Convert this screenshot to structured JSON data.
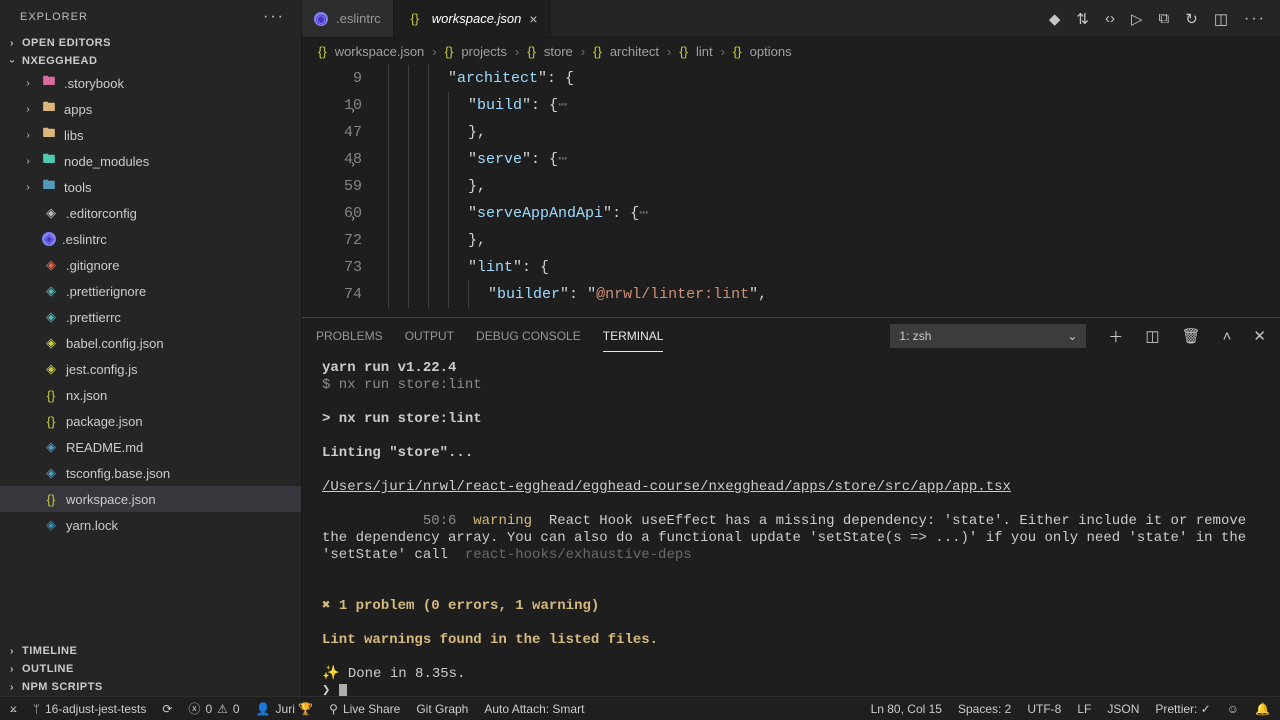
{
  "explorer": {
    "title": "EXPLORER",
    "sections": {
      "open_editors": "OPEN EDITORS",
      "project": "NXEGGHEAD",
      "timeline": "TIMELINE",
      "outline": "OUTLINE",
      "npm_scripts": "NPM SCRIPTS"
    },
    "tree": [
      {
        "type": "folder",
        "label": ".storybook",
        "iconClass": "ic-folder-pink"
      },
      {
        "type": "folder",
        "label": "apps",
        "iconClass": "ic-folder-tan"
      },
      {
        "type": "folder",
        "label": "libs",
        "iconClass": "ic-folder-tan"
      },
      {
        "type": "folder",
        "label": "node_modules",
        "iconClass": "ic-folder-teal"
      },
      {
        "type": "folder",
        "label": "tools",
        "iconClass": "ic-folder-blue"
      },
      {
        "type": "file",
        "label": ".editorconfig",
        "iconClass": "ic-cog"
      },
      {
        "type": "file",
        "label": ".eslintrc",
        "iconClass": "ic-eslint"
      },
      {
        "type": "file",
        "label": ".gitignore",
        "iconClass": "ic-git"
      },
      {
        "type": "file",
        "label": ".prettierignore",
        "iconClass": "ic-prettier"
      },
      {
        "type": "file",
        "label": ".prettierrc",
        "iconClass": "ic-prettier"
      },
      {
        "type": "file",
        "label": "babel.config.json",
        "iconClass": "ic-babel"
      },
      {
        "type": "file",
        "label": "jest.config.js",
        "iconClass": "ic-js"
      },
      {
        "type": "file",
        "label": "nx.json",
        "iconClass": "ic-json"
      },
      {
        "type": "file",
        "label": "package.json",
        "iconClass": "ic-json"
      },
      {
        "type": "file",
        "label": "README.md",
        "iconClass": "ic-md"
      },
      {
        "type": "file",
        "label": "tsconfig.base.json",
        "iconClass": "ic-ts"
      },
      {
        "type": "file",
        "label": "workspace.json",
        "iconClass": "ic-json",
        "selected": true
      },
      {
        "type": "file",
        "label": "yarn.lock",
        "iconClass": "ic-yarn"
      }
    ]
  },
  "tabs": [
    {
      "label": ".eslintrc",
      "icon": "ic-eslint",
      "active": false
    },
    {
      "label": "workspace.json",
      "icon": "ic-json",
      "active": true
    }
  ],
  "breadcrumbs": [
    "workspace.json",
    "projects",
    "store",
    "architect",
    "lint",
    "options"
  ],
  "breadcrumbs_icons": [
    "{}",
    "{}",
    "{}",
    "{}",
    "{}",
    "{}"
  ],
  "code": {
    "lines": [
      {
        "n": 9,
        "indent": 3,
        "key": "architect",
        "after": ": {"
      },
      {
        "n": 10,
        "indent": 4,
        "key": "build",
        "after": ": {",
        "fold": true,
        "ell": true
      },
      {
        "n": 47,
        "indent": 4,
        "raw": "},",
        "plain": true
      },
      {
        "n": 48,
        "indent": 4,
        "key": "serve",
        "after": ": {",
        "fold": true,
        "ell": true
      },
      {
        "n": 59,
        "indent": 4,
        "raw": "},",
        "plain": true
      },
      {
        "n": 60,
        "indent": 4,
        "key": "serveAppAndApi",
        "after": ": {",
        "fold": true,
        "ell": true
      },
      {
        "n": 72,
        "indent": 4,
        "raw": "},",
        "plain": true
      },
      {
        "n": 73,
        "indent": 4,
        "key": "lint",
        "after": ": {"
      },
      {
        "n": 74,
        "indent": 5,
        "key": "builder",
        "after": ": ",
        "str": "@nrwl/linter:lint",
        "tail": ","
      }
    ]
  },
  "panel": {
    "tabs": {
      "problems": "PROBLEMS",
      "output": "OUTPUT",
      "debug": "DEBUG CONSOLE",
      "terminal": "TERMINAL"
    },
    "term_selector": "1: zsh",
    "terminal_lines": {
      "l1": "yarn run v1.22.4",
      "l2": "$ nx run store:lint",
      "l3": "> nx run store:lint",
      "l4": "Linting \"store\"...",
      "l5": "/Users/juri/nrwl/react-egghead/egghead-course/nxegghead/apps/store/src/app/app.tsx",
      "l6a": "  50:6  ",
      "l6b": "warning",
      "l6c": "  React Hook useEffect has a missing dependency: 'state'. Either include it or remove the dependency array. You can also do a functional update 'setState(s => ...)' if you only need 'state' in the 'setState' call  ",
      "l6d": "react-hooks/exhaustive-deps",
      "l7": "✖ 1 problem (0 errors, 1 warning)",
      "l8": "Lint warnings found in the listed files.",
      "l9": "✨  Done in 8.35s.",
      "prompt": "❯ "
    }
  },
  "status": {
    "remote_icon": "⎌",
    "branch": "16-adjust-jest-tests",
    "sync": "⟳",
    "errors": "0",
    "warnings": "0",
    "user": "Juri 🏆",
    "liveshare": "Live Share",
    "gitgraph": "Git Graph",
    "autoattach": "Auto Attach: Smart",
    "lncol": "Ln 80, Col 15",
    "spaces": "Spaces: 2",
    "encoding": "UTF-8",
    "eol": "LF",
    "lang": "JSON",
    "prettier": "Prettier: ✓"
  }
}
